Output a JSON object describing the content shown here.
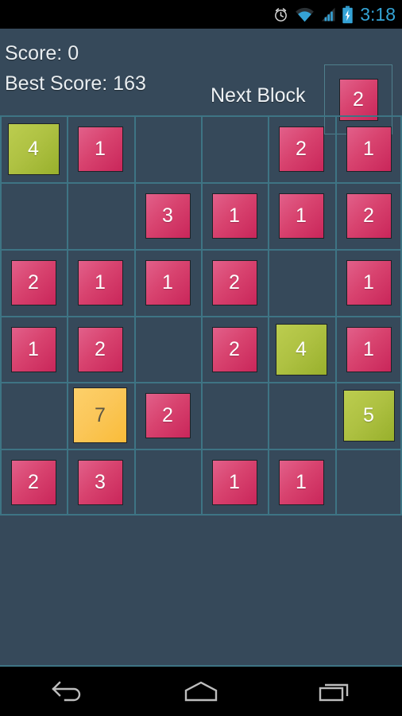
{
  "statusbar": {
    "time": "3:18",
    "icons": [
      "alarm-clock-icon",
      "wifi-icon",
      "cellular-signal-icon",
      "battery-charging-icon"
    ],
    "accent_color": "#34a4d6",
    "background_color": "#000000"
  },
  "header": {
    "score_label": "Score: 0",
    "best_score_label": "Best Score: 163",
    "next_block_label": "Next Block",
    "next_block_value": "2",
    "next_block_color": "pink"
  },
  "theme": {
    "background": "#36495a",
    "grid_line": "#3e7484",
    "tile_pink": "#d8436f",
    "tile_green": "#aec142",
    "tile_yellow": "#fbc75a",
    "text_light": "#e9eef1"
  },
  "board": {
    "columns": 6,
    "rows": 6,
    "cells": [
      [
        {
          "value": "4",
          "color": "green"
        },
        {
          "value": "1",
          "color": "pink"
        },
        null,
        null,
        {
          "value": "2",
          "color": "pink"
        },
        {
          "value": "1",
          "color": "pink"
        }
      ],
      [
        null,
        null,
        {
          "value": "3",
          "color": "pink"
        },
        {
          "value": "1",
          "color": "pink"
        },
        {
          "value": "1",
          "color": "pink"
        },
        {
          "value": "2",
          "color": "pink"
        }
      ],
      [
        {
          "value": "2",
          "color": "pink"
        },
        {
          "value": "1",
          "color": "pink"
        },
        {
          "value": "1",
          "color": "pink"
        },
        {
          "value": "2",
          "color": "pink"
        },
        null,
        {
          "value": "1",
          "color": "pink"
        }
      ],
      [
        {
          "value": "1",
          "color": "pink"
        },
        {
          "value": "2",
          "color": "pink"
        },
        null,
        {
          "value": "2",
          "color": "pink"
        },
        {
          "value": "4",
          "color": "green"
        },
        {
          "value": "1",
          "color": "pink"
        }
      ],
      [
        null,
        {
          "value": "7",
          "color": "yellow"
        },
        {
          "value": "2",
          "color": "pink"
        },
        null,
        null,
        {
          "value": "5",
          "color": "green"
        }
      ],
      [
        {
          "value": "2",
          "color": "pink"
        },
        {
          "value": "3",
          "color": "pink"
        },
        null,
        {
          "value": "1",
          "color": "pink"
        },
        {
          "value": "1",
          "color": "pink"
        },
        null
      ]
    ]
  },
  "navbar": {
    "buttons": [
      {
        "name": "back-button",
        "icon": "back-arrow-icon"
      },
      {
        "name": "home-button",
        "icon": "home-icon"
      },
      {
        "name": "recents-button",
        "icon": "recent-apps-icon"
      }
    ]
  }
}
